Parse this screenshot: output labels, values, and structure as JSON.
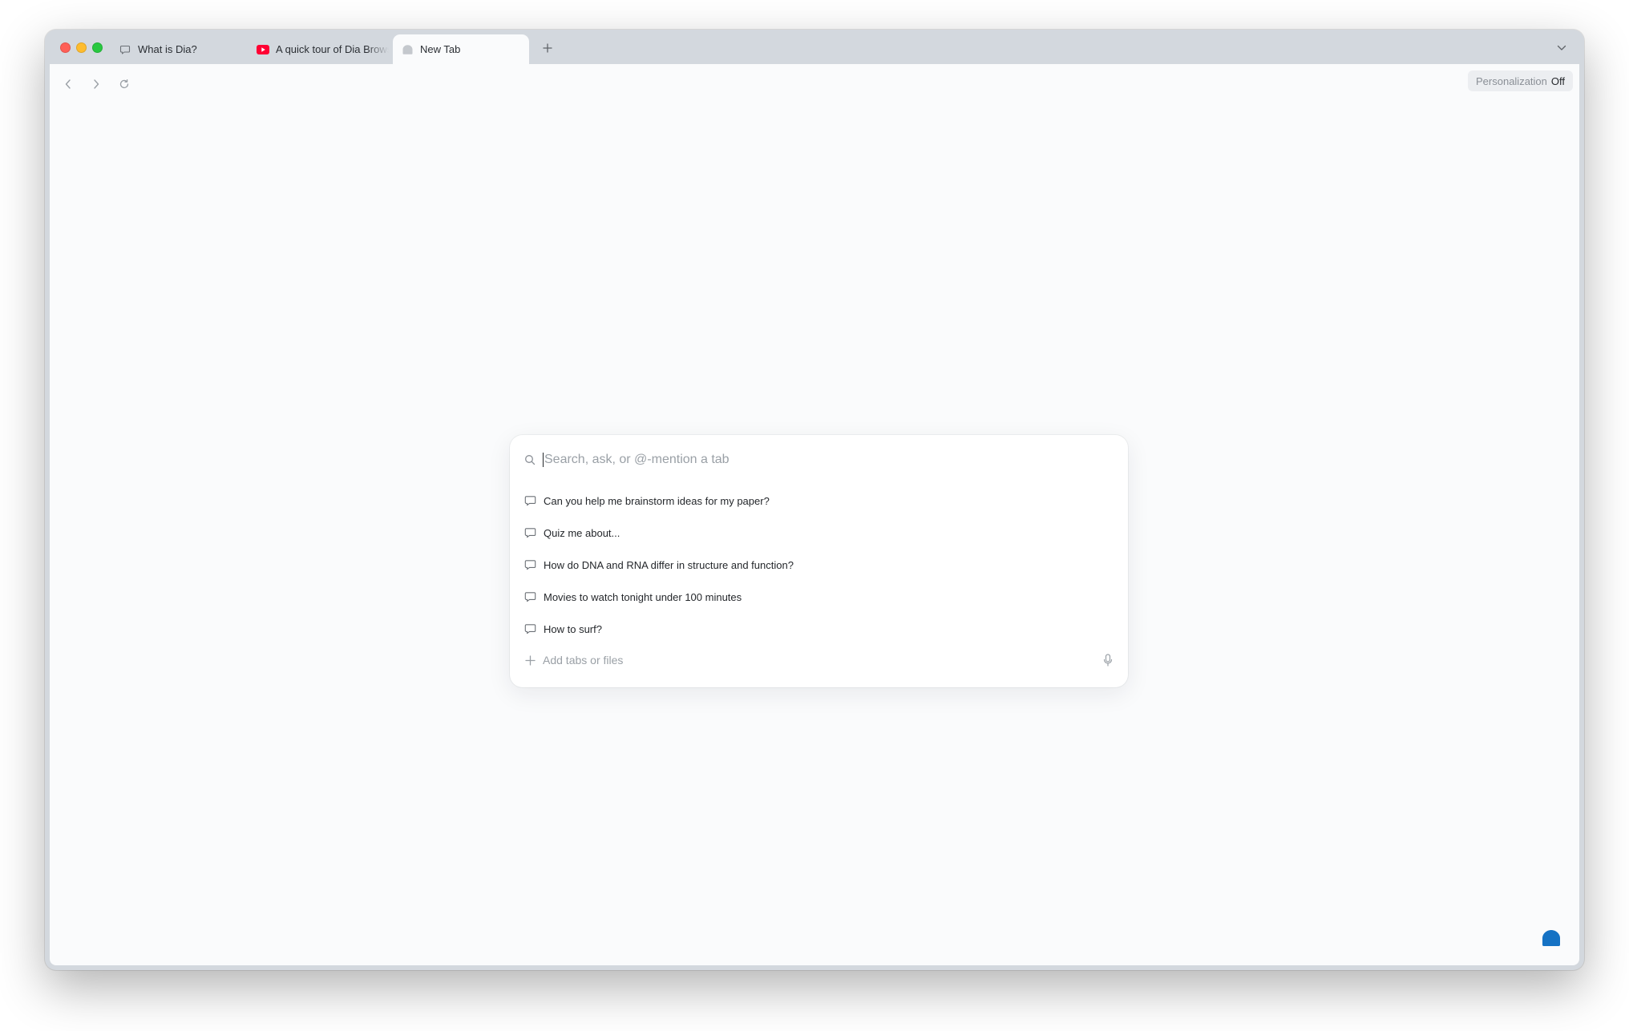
{
  "tabs": [
    {
      "label": "What is Dia?",
      "icon": "chat-bubble-icon",
      "active": false
    },
    {
      "label": "A quick tour of Dia Browser",
      "icon": "youtube-icon",
      "active": false
    },
    {
      "label": "New Tab",
      "icon": "dia-icon",
      "active": true
    }
  ],
  "new_tab_symbol": "+",
  "personalization": {
    "label": "Personalization",
    "state": "Off"
  },
  "search": {
    "placeholder": "Search, ask, or @-mention a tab",
    "value": ""
  },
  "suggestions": [
    "Can you help me brainstorm ideas for my paper?",
    "Quiz me about...",
    "How do DNA and RNA differ in structure and function?",
    "Movies to watch tonight under 100 minutes",
    "How to surf?"
  ],
  "add_context_label": "Add tabs or files",
  "colors": {
    "accent": "#1572c4",
    "youtube": "#ff0033",
    "chrome": "#d3d8de",
    "page": "#fafbfc"
  }
}
